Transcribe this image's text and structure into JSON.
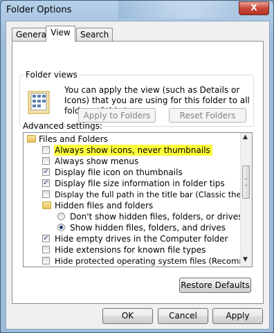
{
  "window": {
    "title": "Folder Options",
    "close_label": "X"
  },
  "tabs": [
    {
      "label": "General"
    },
    {
      "label": "View"
    },
    {
      "label": "Search"
    }
  ],
  "folder_views": {
    "legend": "Folder views",
    "description": "You can apply the view (such as Details or Icons) that you are using for this folder to all folders of this type.",
    "apply_button": "Apply to Folders",
    "reset_button": "Reset Folders"
  },
  "advanced": {
    "label": "Advanced settings:",
    "items": [
      {
        "type": "folder",
        "label": "Files and Folders"
      },
      {
        "type": "checkbox",
        "label": "Always show icons, never thumbnails",
        "checked": false,
        "highlighted": true
      },
      {
        "type": "checkbox",
        "label": "Always show menus",
        "checked": false
      },
      {
        "type": "checkbox",
        "label": "Display file icon on thumbnails",
        "checked": true
      },
      {
        "type": "checkbox",
        "label": "Display file size information in folder tips",
        "checked": true
      },
      {
        "type": "checkbox",
        "label": "Display the full path in the title bar (Classic theme only)",
        "checked": false
      },
      {
        "type": "folder",
        "label": "Hidden files and folders"
      },
      {
        "type": "radio",
        "label": "Don't show hidden files, folders, or drives",
        "checked": false
      },
      {
        "type": "radio",
        "label": "Show hidden files, folders, and drives",
        "checked": true
      },
      {
        "type": "checkbox",
        "label": "Hide empty drives in the Computer folder",
        "checked": true
      },
      {
        "type": "checkbox",
        "label": "Hide extensions for known file types",
        "checked": false
      },
      {
        "type": "checkbox",
        "label": "Hide protected operating system files (Recommended)",
        "checked": false
      }
    ]
  },
  "buttons": {
    "restore_defaults": "Restore Defaults",
    "ok": "OK",
    "cancel": "Cancel",
    "apply": "Apply"
  }
}
